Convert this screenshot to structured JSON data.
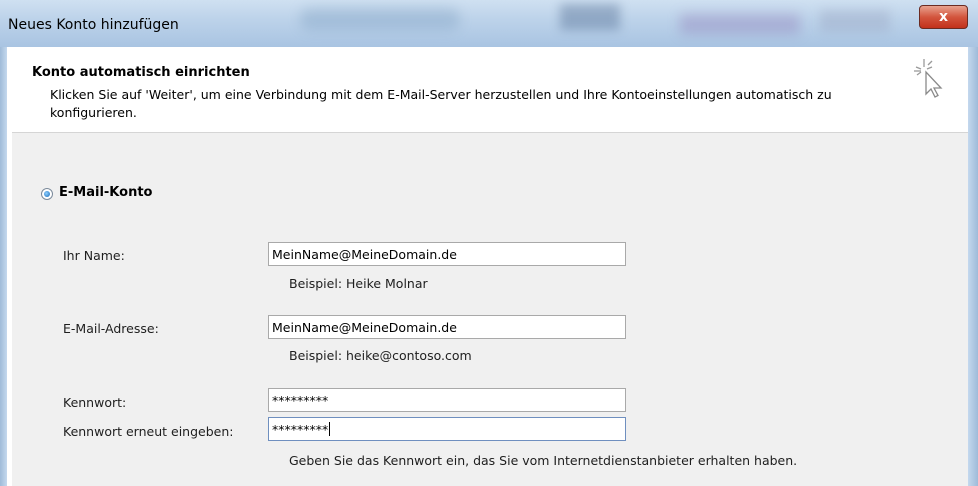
{
  "window": {
    "title": "Neues Konto hinzufügen",
    "close_label": "x"
  },
  "header": {
    "title": "Konto automatisch einrichten",
    "description": "Klicken Sie auf 'Weiter', um eine Verbindung mit dem E-Mail-Server herzustellen und Ihre Kontoeinstellungen automatisch zu konfigurieren."
  },
  "account_type": {
    "label": "E-Mail-Konto",
    "selected": true
  },
  "form": {
    "name": {
      "label": "Ihr Name:",
      "value": "MeinName@MeineDomain.de",
      "hint": "Beispiel: Heike Molnar"
    },
    "email": {
      "label": "E-Mail-Adresse:",
      "value": "MeinName@MeineDomain.de",
      "hint": "Beispiel: heike@contoso.com"
    },
    "password": {
      "label": "Kennwort:",
      "value": "*********"
    },
    "password_confirm": {
      "label": "Kennwort erneut eingeben:",
      "value": "*********",
      "hint": "Geben Sie das Kennwort ein, das Sie vom Internetdienstanbieter erhalten haben."
    }
  },
  "colors": {
    "close_button": "#c2311b",
    "body_background": "#f0f0f0",
    "radio_accent": "#1468b8"
  },
  "icons": {
    "wizard": "wizard-cursor-icon",
    "close": "close-icon"
  }
}
